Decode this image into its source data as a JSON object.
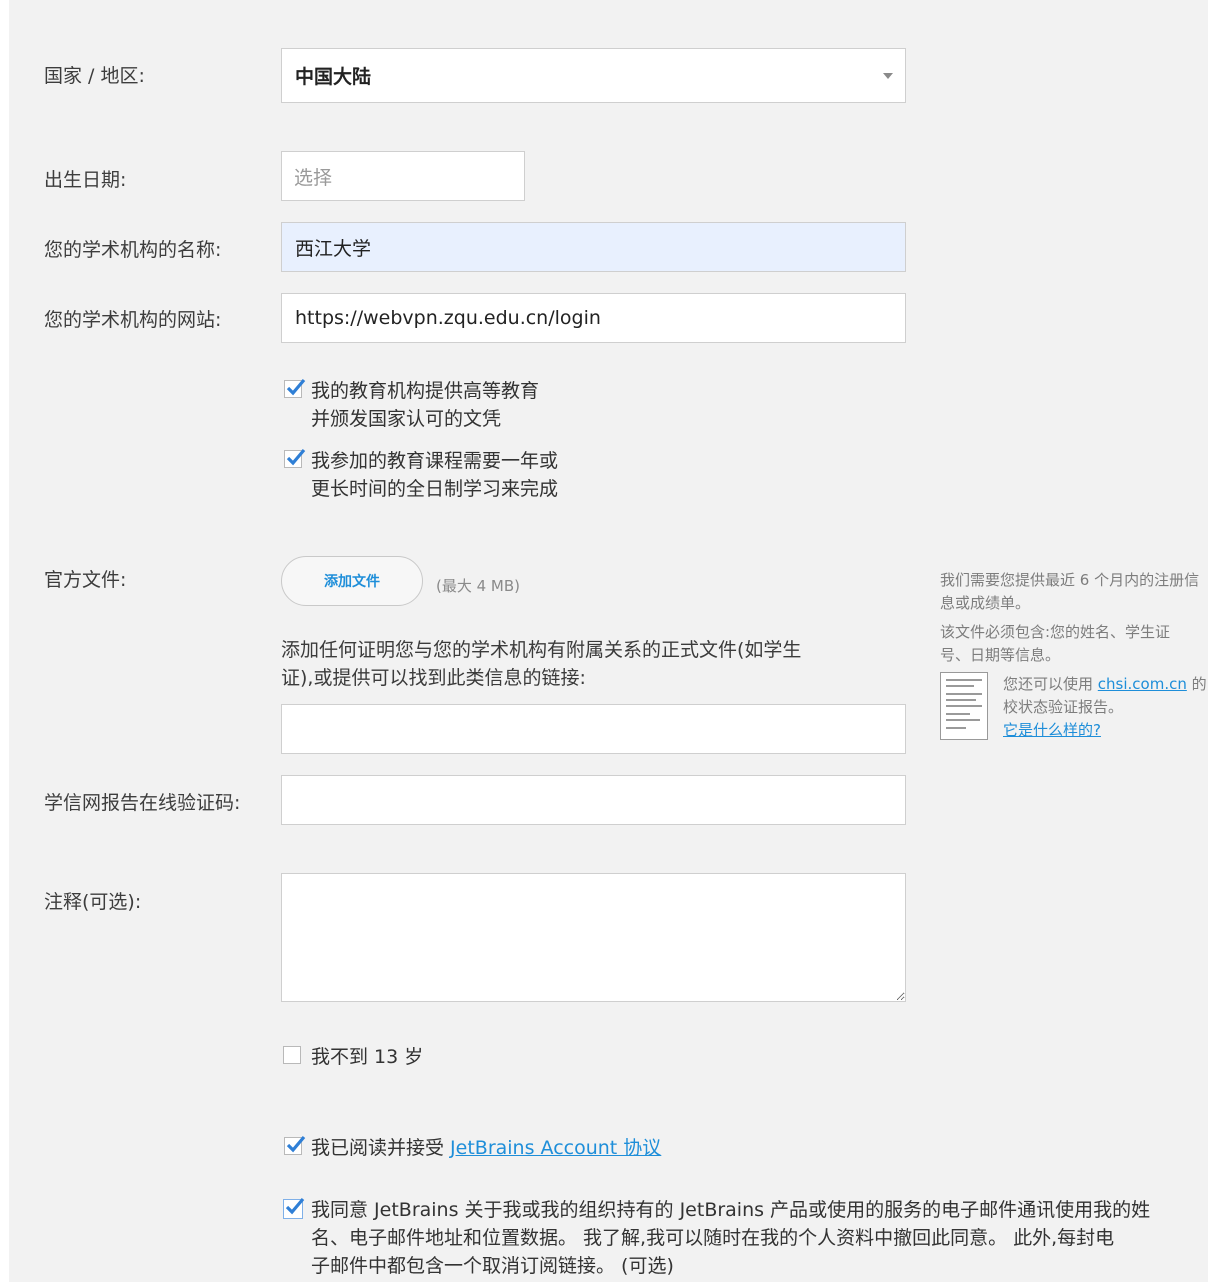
{
  "form": {
    "country_label": "国家 / 地区:",
    "country_value": "中国大陆",
    "birthdate_label": "出生日期:",
    "birthdate_placeholder": "选择",
    "institution_name_label": "您的学术机构的名称:",
    "institution_name_value": "西江大学",
    "institution_site_label": "您的学术机构的网站:",
    "institution_site_value": "https://webvpn.zqu.edu.cn/login",
    "check1_line1": "我的教育机构提供高等教育",
    "check1_line2": "并颁发国家认可的文凭",
    "check2_line1": "我参加的教育课程需要一年或",
    "check2_line2": "更长时间的全日制学习来完成",
    "official_doc_label": "官方文件:",
    "add_file_button": "添加文件",
    "max_size_hint": "(最大 4 MB)",
    "doc_description_line1": "添加任何证明您与您的学术机构有附属关系的正式文件(如学生",
    "doc_description_line2": "证),或提供可以找到此类信息的链接:",
    "chsi_code_label": "学信网报告在线验证码:",
    "notes_label": "注释(可选):",
    "under13_label": "我不到 13 岁",
    "accept_prefix": "我已阅读并接受 ",
    "accept_link": "JetBrains Account 协议",
    "consent_line1": "我同意 JetBrains 关于我或我的组织持有的 JetBrains 产品或使用的服务的电子邮件通讯使用我的姓",
    "consent_line2": "名、电子邮件地址和位置数据。 我了解,我可以随时在我的个人资料中撤回此同意。 此外,每封电",
    "consent_line3": "子邮件中都包含一个取消订阅链接。 (可选)"
  },
  "sidebar": {
    "line1": "我们需要您提供最近 6 个月内的注册信",
    "line2": "息或成绩单。",
    "line3": "该文件必须包含:您的姓名、学生证",
    "line4": "号、日期等信息。",
    "line5_prefix": "您还可以使用 ",
    "line5_link": "chsi.com.cn",
    "line5_suffix": " 的",
    "line6": "校状态验证报告。",
    "example_link": "它是什么样的?"
  },
  "checkbox_states": {
    "check1": true,
    "check2": true,
    "under13": false,
    "accept": true,
    "consent": true
  },
  "colors": {
    "panel_bg": "#f2f2f2",
    "accent": "#1e8ed9",
    "check": "#2f7fd6",
    "highlight_field": "#e8f0fe"
  }
}
